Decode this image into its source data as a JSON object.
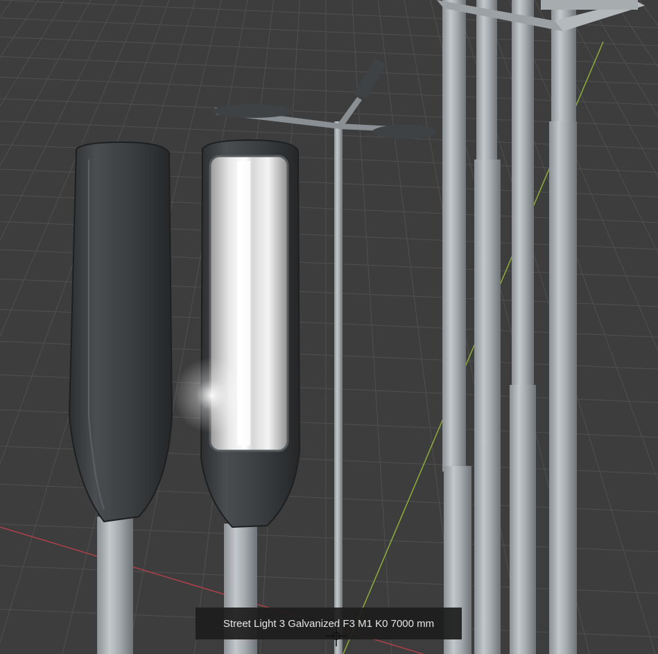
{
  "viewport": {
    "background_color": "#3d3d3d",
    "grid_color": "#4f4f4f",
    "x_axis_color": "#b0404a",
    "y_axis_color": "#8fae3a"
  },
  "caption": {
    "text": "Street Light 3 Galvanized F3 M1 K0 7000 mm"
  },
  "cursor": {
    "icon": "crosshair-cursor-icon"
  }
}
